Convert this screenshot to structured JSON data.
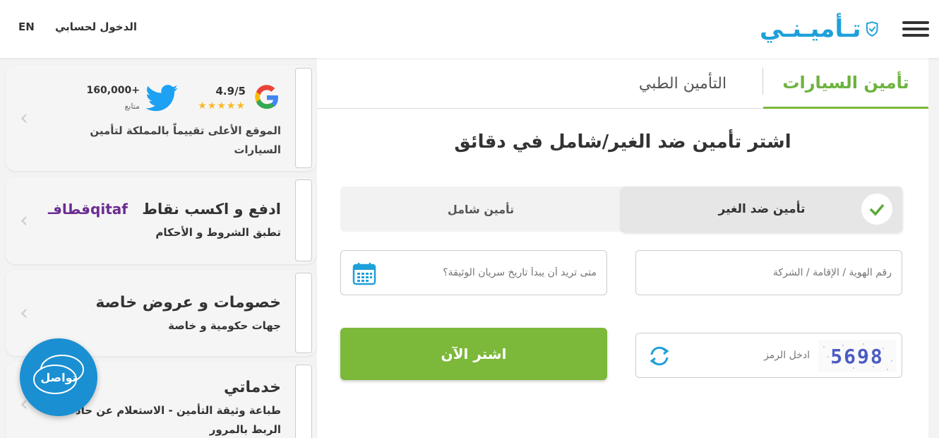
{
  "header": {
    "logo_text": "تـأميـنـي",
    "login_label": "الدخول لحسابي",
    "lang_label": "EN"
  },
  "tabs": {
    "car_label": "تأمين السيارات",
    "medical_label": "التأمين الطبي"
  },
  "form": {
    "headline": "اشتر تأمين ضد الغير/شامل في دقائق",
    "type_third_party": "تأمين ضد الغير",
    "type_comprehensive": "تأمين شامل",
    "id_placeholder": "رقم الهوية / الإقامة / الشركة",
    "date_placeholder": "متى تريد أن يبدأ تاريخ سريان الوثيقة؟",
    "captcha_placeholder": "ادخل الرمز",
    "captcha_code": "5698",
    "buy_label": "اشتر الآن"
  },
  "sidebar": {
    "rating_value": "4.9/5",
    "stars": "★★★★★",
    "followers_count": "160,000+",
    "followers_label": "متابع",
    "rating_desc": "الموقع الأعلى تقييماً بالمملكة لتأمين السيارات",
    "qitaf_title": "ادفع و اكسب نقاط",
    "qitaf_brand": "قطافـqitaf",
    "qitaf_terms": "تطبق الشروط و الأحكام",
    "offers_title": "خصومات و عروض خاصة",
    "offers_sub": "جهات حكومية و خاصة",
    "services_title": "خدماتي",
    "services_sub": "طباعة وثيقة التأمين - الاستعلام عن حادث - الربط بالمرور"
  },
  "chat": {
    "label": "تواصل"
  },
  "colors": {
    "brand_blue": "#1fa0d9",
    "brand_green": "#7cb83a",
    "qitaf_purple": "#6b2c91"
  }
}
